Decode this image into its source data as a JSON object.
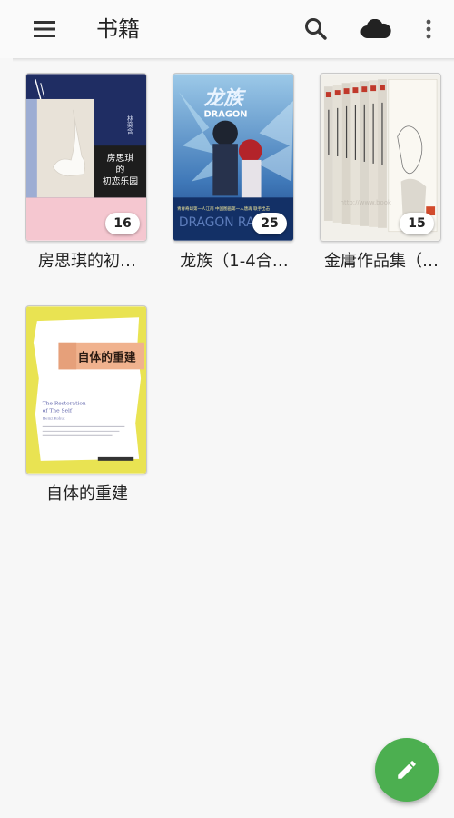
{
  "app_bar": {
    "title": "书籍",
    "icons": {
      "menu": "menu-icon",
      "search": "search-icon",
      "cloud": "cloud-icon",
      "more": "more-vert-icon"
    }
  },
  "books": [
    {
      "title": "房思琪的初…",
      "count": "16",
      "cover": {
        "spine_text": "林奕含",
        "title_lines": [
          "房思琪",
          "的",
          "初恋乐园"
        ]
      }
    },
    {
      "title": "龙族（1-4合…",
      "count": "25",
      "cover": {
        "title_cn": "龙族",
        "title_en": "DRAGON",
        "bottom_text": "DRAGON RA",
        "blurb": "青春奇幻第一人江南 中国图画第一人唐再 联手出击"
      }
    },
    {
      "title": "金庸作品集（…",
      "count": "15",
      "cover": {
        "watermark": "http://www.book"
      }
    },
    {
      "title": "自体的重建",
      "count": "",
      "cover": {
        "title_cn": "自体的重建",
        "title_en_lines": [
          "The Restoration",
          "of The Self"
        ],
        "author": "Heinz Kohut"
      }
    }
  ],
  "fab": {
    "icon": "edit-icon"
  },
  "colors": {
    "fab": "#4caf50",
    "background": "#f7f7f7",
    "app_bar": "#fafafa"
  }
}
